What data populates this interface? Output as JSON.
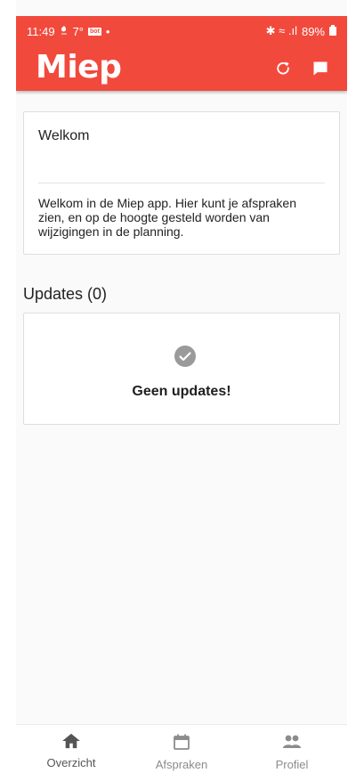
{
  "statusbar": {
    "time": "11:49",
    "temperature": "7°",
    "mini_badge": "bot",
    "dot": "•",
    "signal_icons": "✱ ≈ .ıl",
    "battery_percent": "89%"
  },
  "appbar": {
    "logo_text": "Miep",
    "refresh_icon": "refresh-icon",
    "message_icon": "message-icon"
  },
  "welcome": {
    "title": "Welkom",
    "body": "Welkom in de Miep app. Hier kunt je afspraken zien, en op de hoogte gesteld worden van wijzigingen in de planning."
  },
  "updates": {
    "title": "Updates (0)",
    "empty_text": "Geen updates!",
    "icon": "check-circle-icon"
  },
  "bottom_nav": {
    "items": [
      {
        "label": "Overzicht",
        "icon": "home-icon"
      },
      {
        "label": "Afspraken",
        "icon": "calendar-icon"
      },
      {
        "label": "Profiel",
        "icon": "people-icon"
      }
    ]
  },
  "colors": {
    "accent": "#f14a3d",
    "card_border": "#dedede"
  }
}
